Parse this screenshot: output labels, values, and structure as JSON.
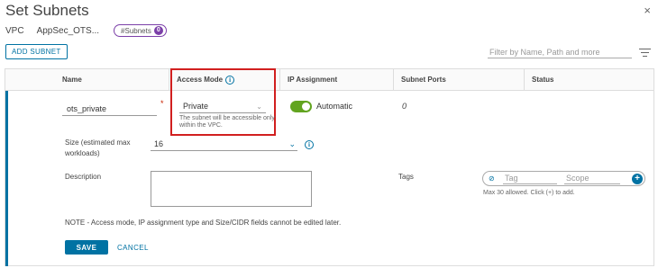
{
  "dialog": {
    "title": "Set Subnets",
    "close_label": "×"
  },
  "context": {
    "vpc_label": "VPC",
    "vpc_name": "AppSec_OTS...",
    "subnets_badge_label": "#Subnets",
    "subnets_count": "0"
  },
  "toolbar": {
    "add_subnet_label": "ADD SUBNET",
    "filter_placeholder": "Filter by Name, Path and more"
  },
  "table": {
    "columns": [
      "Name",
      "Access Mode",
      "IP Assignment",
      "Subnet Ports",
      "Status"
    ]
  },
  "row": {
    "name_value": "ots_private",
    "required_mark": "*",
    "access_mode_value": "Private",
    "access_mode_help": "The subnet will be accessible only within the VPC.",
    "ip_assignment_label": "Automatic",
    "subnet_ports_value": "0",
    "status_value": ""
  },
  "form": {
    "size_label": "Size (estimated max workloads)",
    "size_value": "16",
    "description_label": "Description",
    "tags_label": "Tags",
    "tag_placeholder": "Tag",
    "scope_placeholder": "Scope",
    "tags_help": "Max 30 allowed. Click (+) to add.",
    "note": "NOTE - Access mode, IP assignment type and Size/CIDR fields cannot be edited later.",
    "save_label": "SAVE",
    "cancel_label": "CANCEL"
  },
  "colors": {
    "accent": "#0072a3",
    "toggle_on": "#62a420",
    "highlight": "#d11f1f",
    "badge": "#7b3fa8"
  }
}
